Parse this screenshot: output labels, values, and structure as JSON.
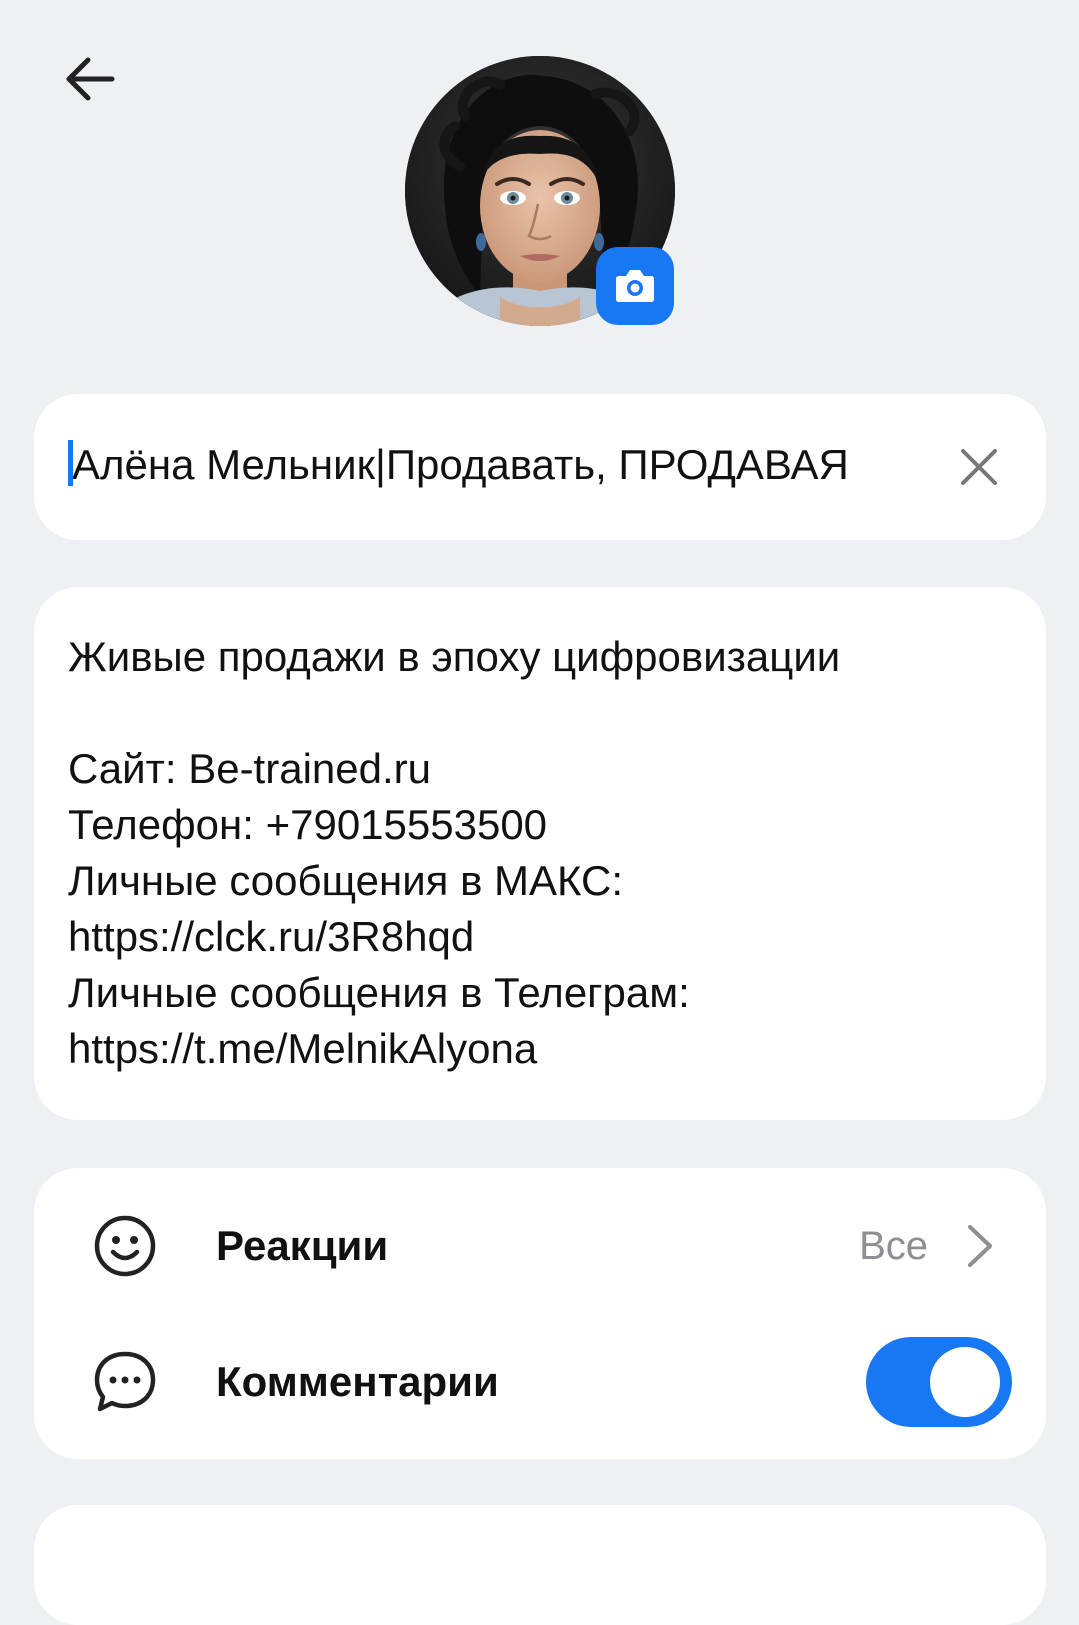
{
  "header": {
    "back_icon": "arrow-left-icon"
  },
  "avatar": {
    "camera_icon": "camera-icon",
    "badge_color": "#1877f2"
  },
  "name_field": {
    "value": "Алёна Мельник|Продавать, ПРОДАВАЯ",
    "clear_icon": "close-icon"
  },
  "description": {
    "text": "Живые продажи в эпоху цифровизации\n\nСайт: Be-trained.ru\nТелефон: +79015553500\nЛичные сообщения в МАКС:\nhttps://clck.ru/3R8hqd\nЛичные сообщения в Телеграм:\nhttps://t.me/MelnikAlyona"
  },
  "settings": {
    "reactions": {
      "label": "Реакции",
      "value": "Все",
      "icon": "smile-icon"
    },
    "comments": {
      "label": "Комментарии",
      "icon": "chat-bubble-icon",
      "enabled": true
    }
  },
  "colors": {
    "accent": "#1877f2",
    "background": "#eef0f4",
    "card": "#ffffff",
    "secondary_text": "#8e8e93"
  }
}
